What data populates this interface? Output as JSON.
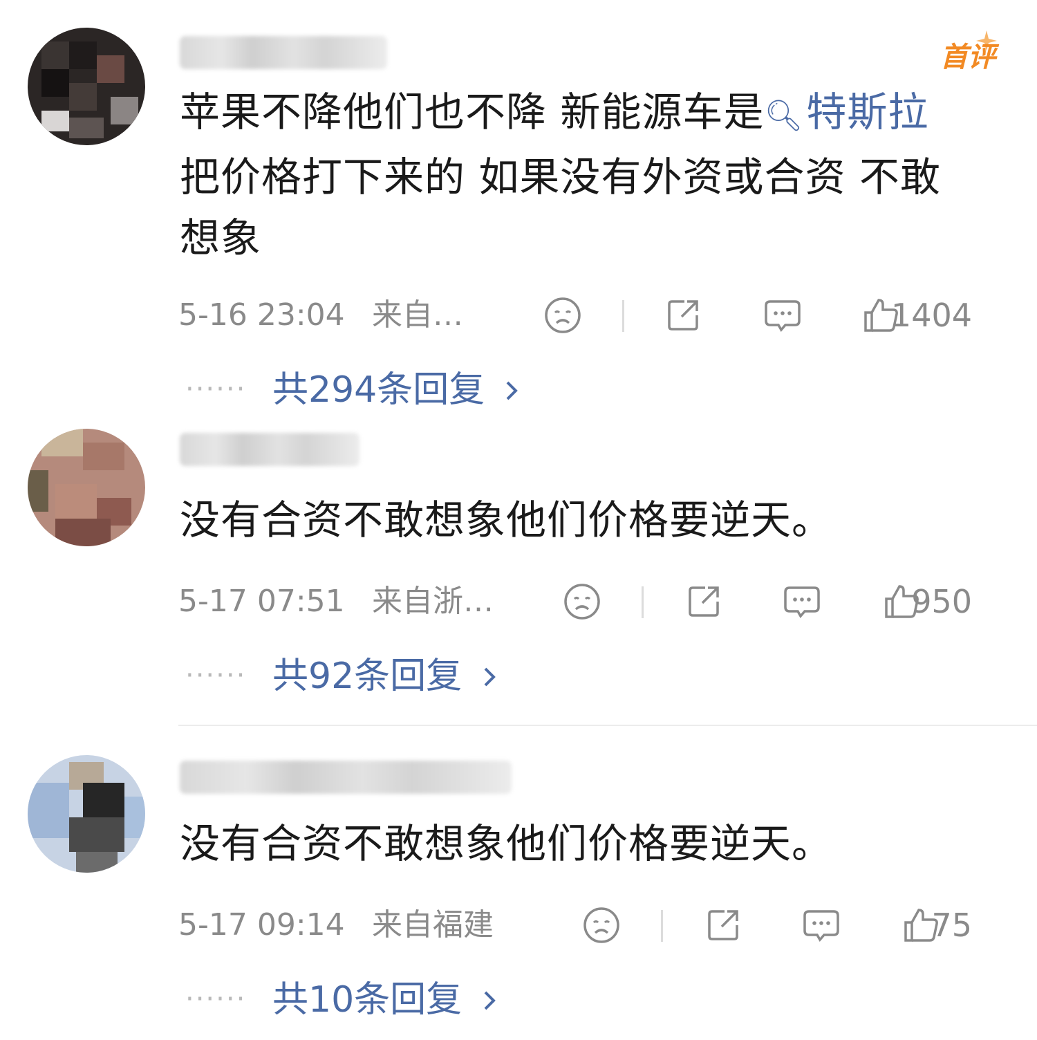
{
  "comments": [
    {
      "text_line1": "苹果不降他们也不降 新能源车是",
      "topic": "特斯拉",
      "text_line2": "把价格打下来的 如果没有外资或合资 不敢",
      "text_line3": "想象",
      "date": "5-16 23:04",
      "location": "来自…",
      "likes": "1404",
      "replies_label": "共294条回复",
      "badge": "首评"
    },
    {
      "text_line1": "没有合资不敢想象他们价格要逆天。",
      "date": "5-17 07:51",
      "location": "来自浙…",
      "likes": "950",
      "replies_label": "共92条回复"
    },
    {
      "text_line1": "没有合资不敢想象他们价格要逆天。",
      "date": "5-17 09:14",
      "location": "来自福建",
      "likes": "75",
      "replies_label": "共10条回复"
    }
  ],
  "icons": {
    "dislike": "sad-face-icon",
    "share": "share-icon",
    "comment": "comment-bubble-icon",
    "like": "thumbs-up-icon",
    "reply_arrow": "chevron-right-icon"
  },
  "colors": {
    "link": "#4a6aa5",
    "meta": "#8a8a8a",
    "badge": "#f28a24"
  }
}
